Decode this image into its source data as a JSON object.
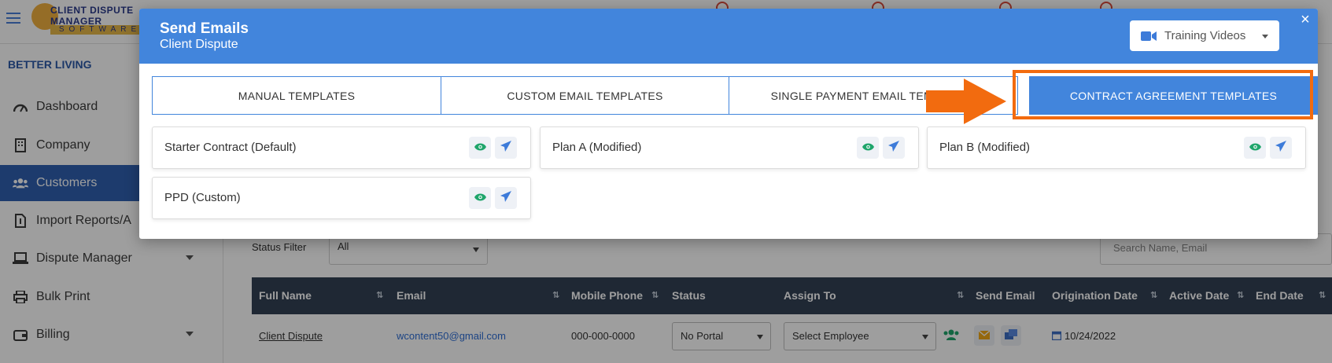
{
  "app": {
    "logo": {
      "line1": "CLIENT DISPUTE",
      "line2": "MANAGER",
      "line3": "SOFTWARE"
    },
    "brand": "BETTER LIVING",
    "sidebar": [
      {
        "label": "Dashboard",
        "icon": "gauge-icon"
      },
      {
        "label": "Company",
        "icon": "building-icon"
      },
      {
        "label": "Customers",
        "icon": "users-icon",
        "active": true
      },
      {
        "label": "Import Reports/A",
        "icon": "file-import-icon"
      },
      {
        "label": "Dispute Manager",
        "icon": "laptop-icon",
        "has_children": true
      },
      {
        "label": "Bulk Print",
        "icon": "printer-icon"
      },
      {
        "label": "Billing",
        "icon": "wallet-icon",
        "has_children": true
      }
    ],
    "filter": {
      "label": "Status Filter",
      "value": "All"
    },
    "search": {
      "placeholder": "Search Name, Email"
    },
    "table": {
      "headers": [
        "Full Name",
        "Email",
        "Mobile Phone",
        "Status",
        "Assign To",
        "Send Email",
        "Origination Date",
        "Active Date",
        "End Date"
      ],
      "row": {
        "full_name": "Client Dispute",
        "email": "wcontent50@gmail.com",
        "mobile": "000-000-0000",
        "status": "No Portal",
        "assign_to": "Select Employee",
        "origination_date": "10/24/2022"
      }
    }
  },
  "modal": {
    "title": "Send Emails",
    "subtitle": "Client Dispute",
    "training_videos": "Training Videos",
    "close": "×",
    "tabs": [
      {
        "label": "MANUAL TEMPLATES",
        "active": false
      },
      {
        "label": "CUSTOM EMAIL TEMPLATES",
        "active": false
      },
      {
        "label": "SINGLE PAYMENT EMAIL TEMPLATES",
        "active": false
      },
      {
        "label": "CONTRACT AGREEMENT TEMPLATES",
        "active": true
      }
    ],
    "templates": [
      {
        "label": "Starter Contract (Default)"
      },
      {
        "label": "Plan A (Modified)"
      },
      {
        "label": "Plan B (Modified)"
      },
      {
        "label": "PPD (Custom)"
      }
    ]
  },
  "colors": {
    "accent": "#4285dc",
    "highlight": "#f26b0f",
    "eye": "#1fa56b",
    "send": "#3d7bd9"
  }
}
